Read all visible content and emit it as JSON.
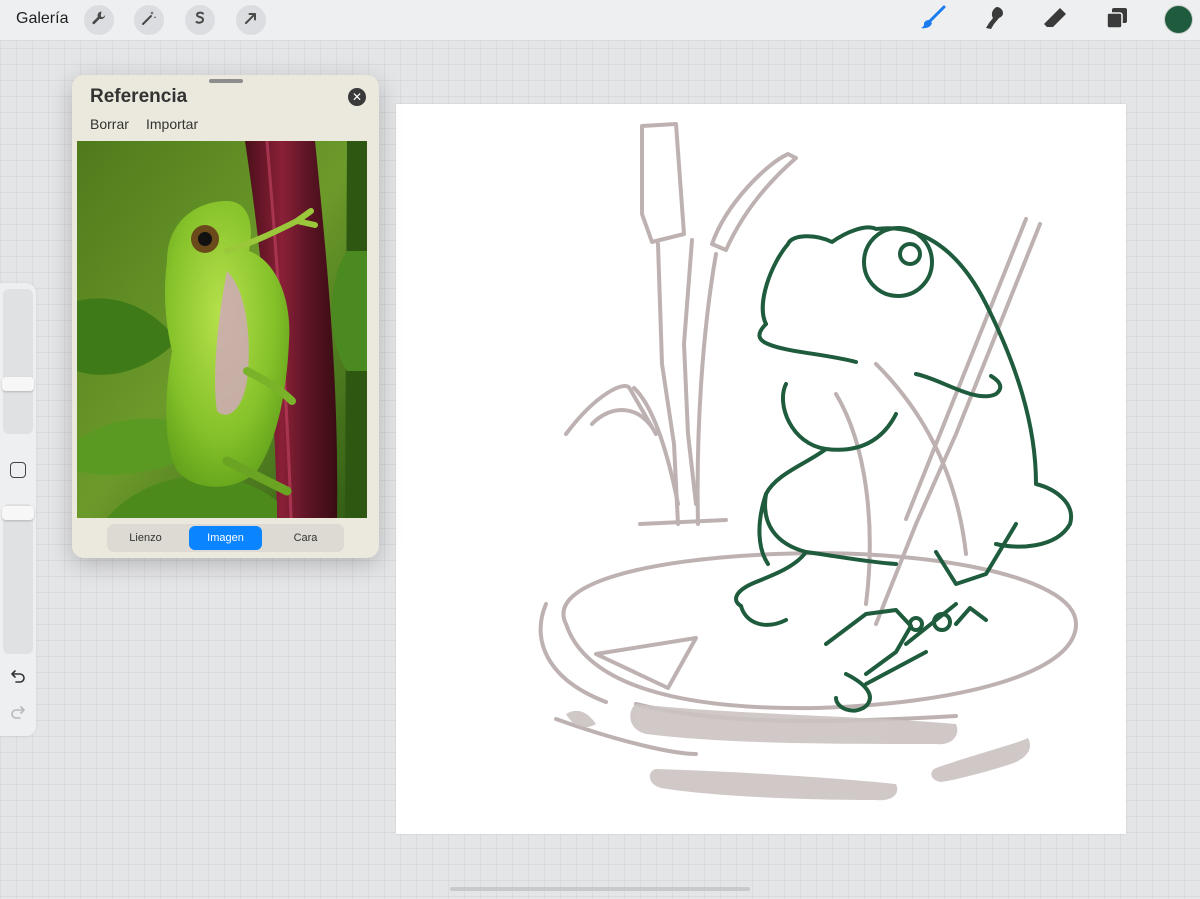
{
  "topbar": {
    "gallery_label": "Galería",
    "left_tools": [
      "wrench-icon",
      "magic-wand-icon",
      "selection-icon",
      "transform-arrow-icon"
    ],
    "right_tools": [
      "brush-icon",
      "smudge-icon",
      "eraser-icon",
      "layers-icon"
    ],
    "active_color": "#1e5c3d"
  },
  "reference": {
    "title": "Referencia",
    "actions": [
      "Borrar",
      "Importar"
    ],
    "tabs": [
      "Lienzo",
      "Imagen",
      "Cara"
    ],
    "active_tab": "Imagen"
  },
  "colors": {
    "accent": "#0a84ff",
    "ink": "#1e5c3d",
    "sketch": "#bdb2b1"
  }
}
